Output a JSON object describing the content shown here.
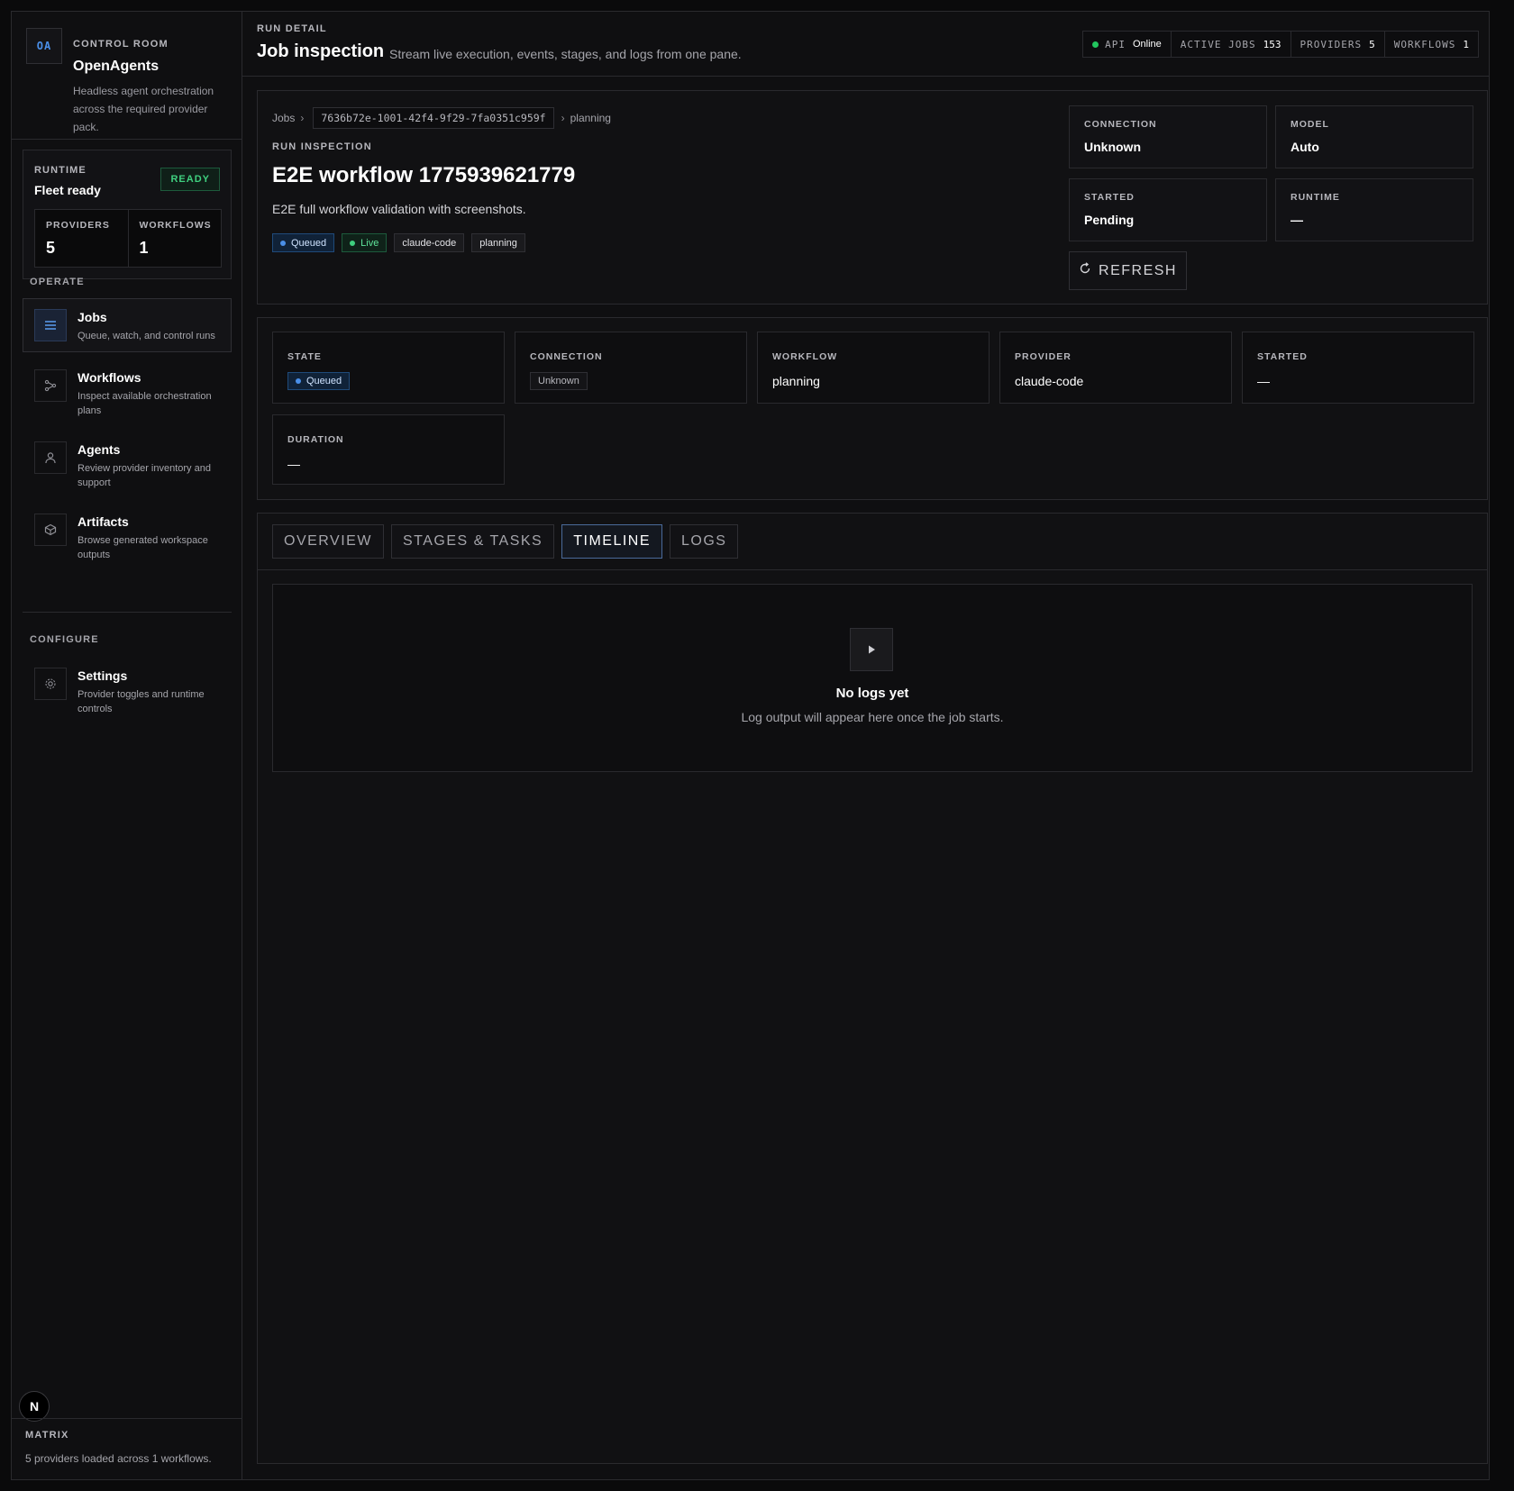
{
  "brand": {
    "logo": "OA",
    "kicker": "CONTROL ROOM",
    "name": "OpenAgents",
    "description": "Headless agent orchestration across the required provider pack."
  },
  "runtime": {
    "kicker": "RUNTIME",
    "title": "Fleet ready",
    "badge": "READY",
    "stats": [
      {
        "label": "PROVIDERS",
        "value": "5"
      },
      {
        "label": "WORKFLOWS",
        "value": "1"
      }
    ]
  },
  "nav": {
    "operate_label": "OPERATE",
    "configure_label": "CONFIGURE",
    "items": [
      {
        "label": "Jobs",
        "desc": "Queue, watch, and control runs",
        "icon": "list-icon"
      },
      {
        "label": "Workflows",
        "desc": "Inspect available orchestration plans",
        "icon": "workflow-icon"
      },
      {
        "label": "Agents",
        "desc": "Review provider inventory and support",
        "icon": "user-icon"
      },
      {
        "label": "Artifacts",
        "desc": "Browse generated workspace outputs",
        "icon": "cube-icon"
      }
    ],
    "settings": {
      "label": "Settings",
      "desc": "Provider toggles and runtime controls",
      "icon": "gear-icon"
    }
  },
  "matrix": {
    "kicker": "MATRIX",
    "text": "5 providers loaded across 1 workflows.",
    "badge": "N"
  },
  "topbar": {
    "kicker": "RUN DETAIL",
    "title": "Job inspection",
    "subtitle": "Stream live execution, events, stages, and logs from one pane.",
    "status": {
      "api_label": "API",
      "api_value": "Online",
      "jobs_label": "ACTIVE JOBS",
      "jobs_value": "153",
      "providers_label": "PROVIDERS",
      "providers_value": "5",
      "workflows_label": "WORKFLOWS",
      "workflows_value": "1"
    }
  },
  "run": {
    "breadcrumb": {
      "root": "Jobs",
      "sep": "›",
      "id": "7636b72e-1001-42f4-9f29-7fa0351c959f",
      "leaf": "planning"
    },
    "kicker": "RUN INSPECTION",
    "title": "E2E workflow 1775939621779",
    "description": "E2E full workflow validation with screenshots.",
    "chips": {
      "state": "Queued",
      "live": "Live",
      "provider": "claude-code",
      "workflow": "planning"
    },
    "meta": {
      "connection_label": "CONNECTION",
      "connection_value": "Unknown",
      "model_label": "MODEL",
      "model_value": "Auto",
      "started_label": "STARTED",
      "started_value": "Pending",
      "runtime_label": "RUNTIME",
      "runtime_value": "—"
    },
    "refresh_label": "REFRESH"
  },
  "stats": {
    "state_label": "STATE",
    "state_value": "Queued",
    "connection_label": "CONNECTION",
    "connection_value": "Unknown",
    "workflow_label": "WORKFLOW",
    "workflow_value": "planning",
    "provider_label": "PROVIDER",
    "provider_value": "claude-code",
    "started_label": "STARTED",
    "started_value": "—",
    "duration_label": "DURATION",
    "duration_value": "—"
  },
  "tabs": [
    {
      "label": "OVERVIEW",
      "active": false
    },
    {
      "label": "STAGES & TASKS",
      "active": false
    },
    {
      "label": "TIMELINE",
      "active": true
    },
    {
      "label": "LOGS",
      "active": false
    }
  ],
  "empty": {
    "title": "No logs yet",
    "text": "Log output will appear here once the job starts.",
    "icon": "play-icon"
  },
  "colors": {
    "accent_blue": "#4a8fe8",
    "online_green": "#22c55e",
    "ready_green": "#3fd07f",
    "background": "#0f0f11"
  }
}
